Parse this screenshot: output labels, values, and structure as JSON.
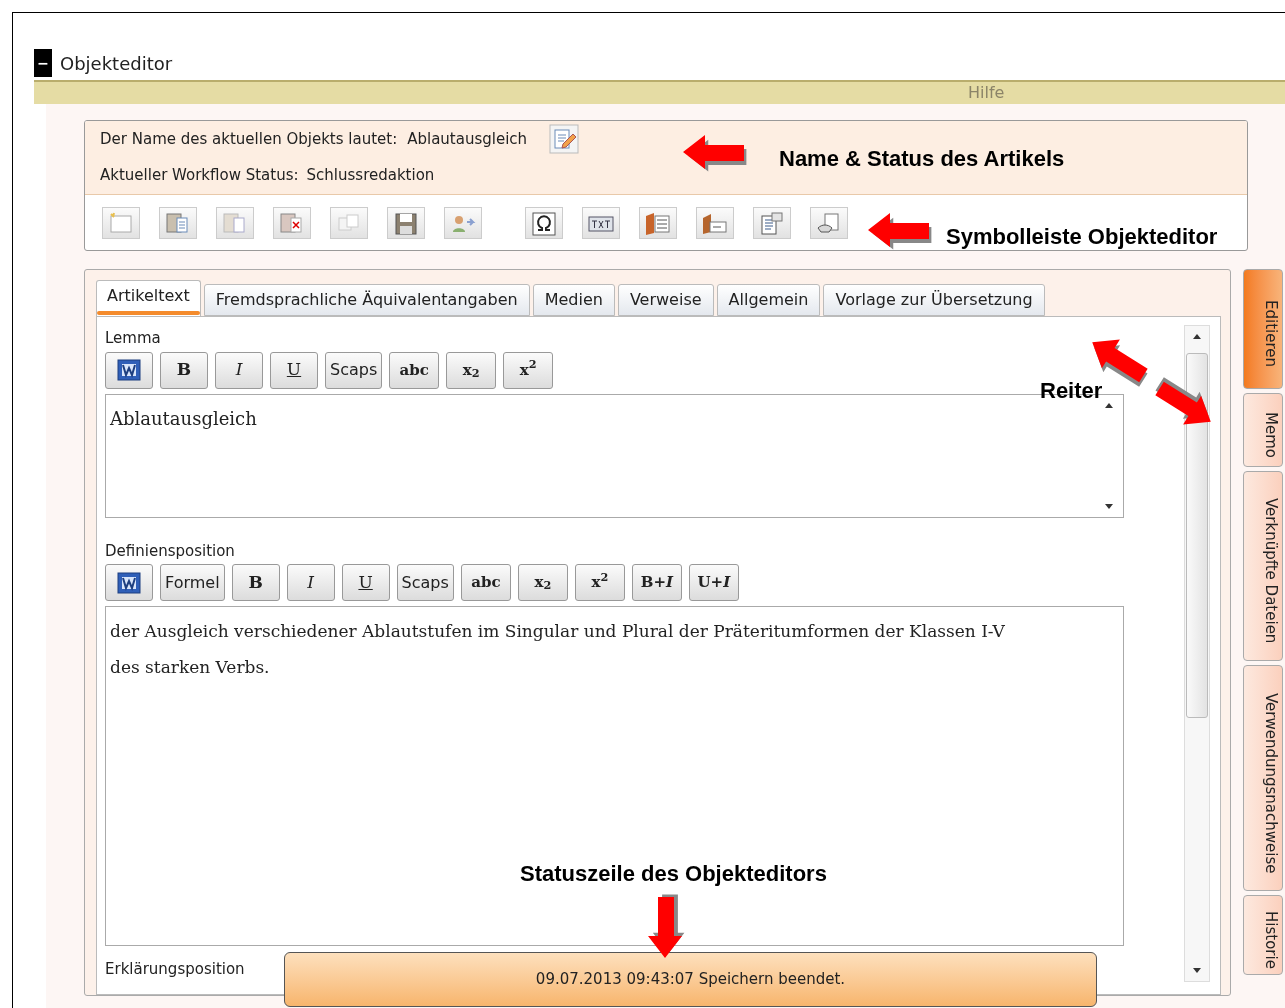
{
  "window": {
    "collapse_glyph": "−",
    "title": "Objekteditor"
  },
  "help_bar": {
    "label": "Hilfe"
  },
  "header": {
    "name_label": "Der Name des aktuellen Objekts lautet:",
    "name_value": "Ablautausgleich",
    "status_label": "Aktueller Workflow Status:",
    "status_value": "Schlussredaktion"
  },
  "tabs": [
    {
      "label": "Artikeltext",
      "selected": true
    },
    {
      "label": "Fremdsprachliche Äquivalentangaben",
      "selected": false
    },
    {
      "label": "Medien",
      "selected": false
    },
    {
      "label": "Verweise",
      "selected": false
    },
    {
      "label": "Allgemein",
      "selected": false
    },
    {
      "label": "Vorlage zur Übersetzung",
      "selected": false
    }
  ],
  "side_tabs": [
    {
      "label": "Editieren",
      "selected": true
    },
    {
      "label": "Memo",
      "selected": false
    },
    {
      "label": "Verknüpfte Dateien",
      "selected": false
    },
    {
      "label": "Verwendungsnachweise",
      "selected": false
    },
    {
      "label": "Historie",
      "selected": false
    }
  ],
  "fields": [
    {
      "label": "Lemma",
      "kind": "short",
      "toolbar": [
        {
          "kind": "word"
        },
        {
          "kind": "bold",
          "label": "B"
        },
        {
          "kind": "italic",
          "label": "I"
        },
        {
          "kind": "underline",
          "label": "U"
        },
        {
          "kind": "plain",
          "label": "Scaps"
        },
        {
          "kind": "serif",
          "label": "abc"
        },
        {
          "kind": "serif",
          "label": "x$_{2}$"
        },
        {
          "kind": "serif",
          "label": "x$^{2}$"
        }
      ],
      "value": "Ablautausgleich"
    },
    {
      "label": "Definiensposition",
      "kind": "tall",
      "toolbar": [
        {
          "kind": "word"
        },
        {
          "kind": "plain",
          "label": "Formel"
        },
        {
          "kind": "bold",
          "label": "B"
        },
        {
          "kind": "italic",
          "label": "I"
        },
        {
          "kind": "underline",
          "label": "U"
        },
        {
          "kind": "plain",
          "label": "Scaps"
        },
        {
          "kind": "serif",
          "label": "abc"
        },
        {
          "kind": "serif",
          "label": "x$_{2}$"
        },
        {
          "kind": "serif",
          "label": "x$^{2}$"
        },
        {
          "kind": "serif",
          "label": "**B**+*I*"
        },
        {
          "kind": "serif",
          "label": "U+*I*"
        }
      ],
      "value": "der Ausgleich verschiedener Ablautstufen im Singular und Plural der Präteritumformen der Klassen I-V des starken Verbs."
    },
    {
      "label": "Erklärungsposition",
      "kind": "label_only"
    }
  ],
  "status_bar": {
    "message": "09.07.2013 09:43:07 Speichern beendet."
  },
  "annotations": [
    {
      "kind": "name",
      "text": "Name & Status des Artikels"
    },
    {
      "kind": "toolbar",
      "text": "Symbolleiste Objekteditor"
    },
    {
      "kind": "tabs",
      "text": "Reiter"
    },
    {
      "kind": "status",
      "text": "Statuszeile des Objekteditors"
    }
  ]
}
